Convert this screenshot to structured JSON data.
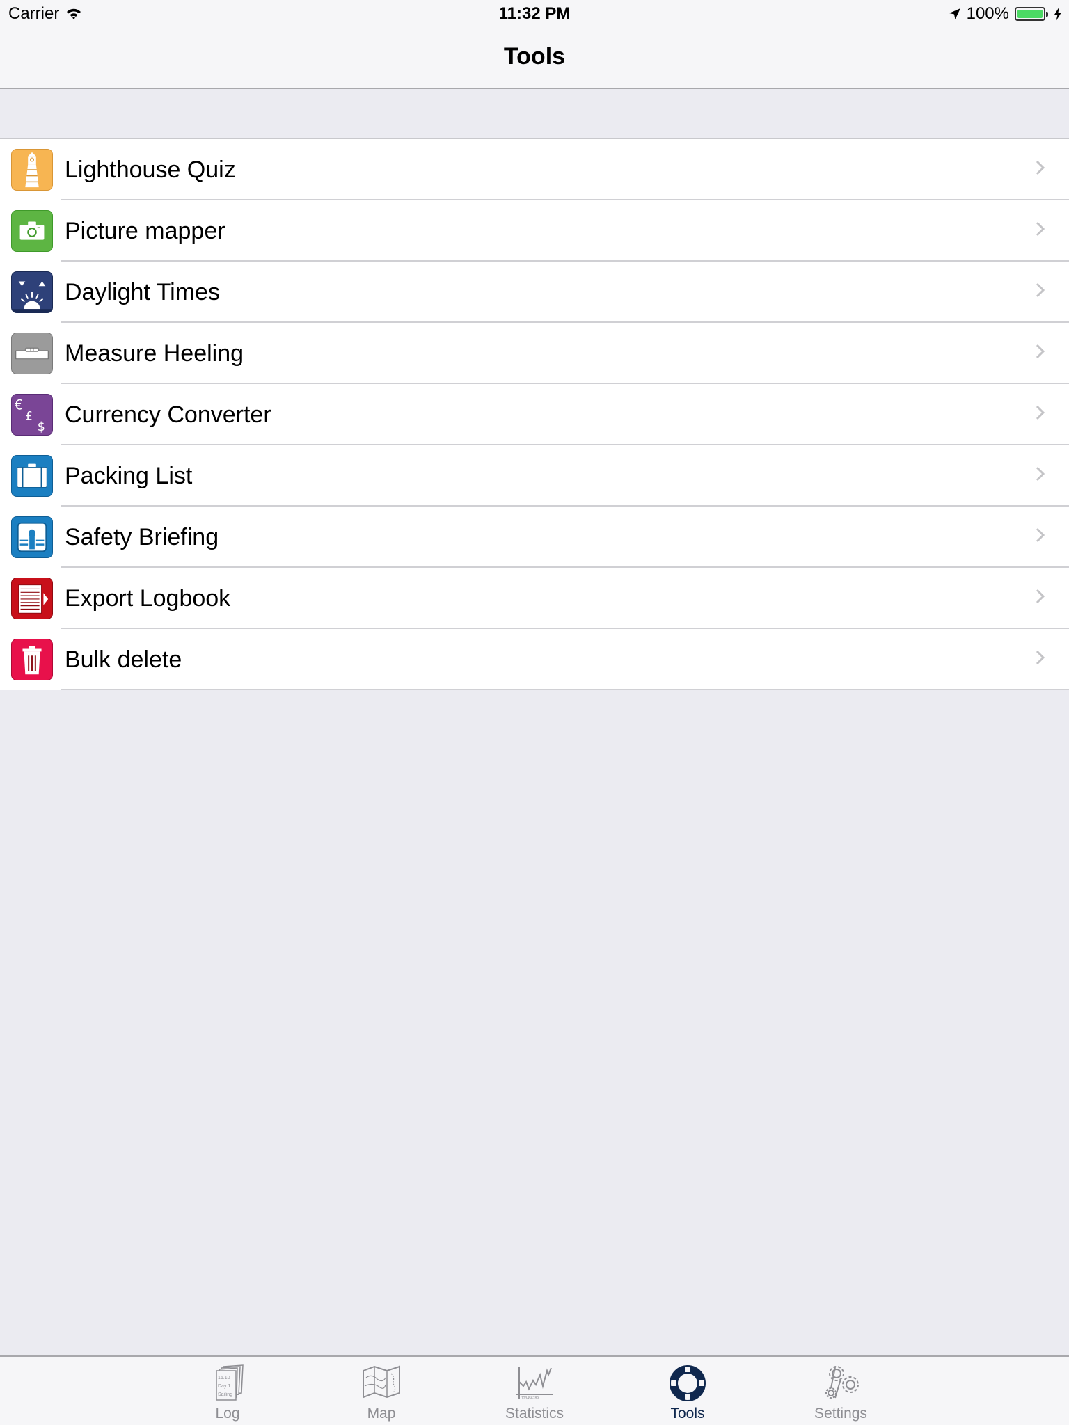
{
  "status_bar": {
    "carrier": "Carrier",
    "time": "11:32 PM",
    "battery_percent_text": "100%",
    "battery_level": 1.0,
    "icons": [
      "wifi-icon",
      "location-arrow-icon",
      "battery-icon",
      "charging-bolt-icon"
    ]
  },
  "nav_bar": {
    "title": "Tools"
  },
  "tools": {
    "items": [
      {
        "label": "Lighthouse Quiz",
        "icon": "lighthouse-icon",
        "color": "#f7b552"
      },
      {
        "label": "Picture mapper",
        "icon": "camera-icon",
        "color": "#5db543"
      },
      {
        "label": "Daylight Times",
        "icon": "sunrise-icon",
        "color": "#2e4179"
      },
      {
        "label": "Measure Heeling",
        "icon": "spirit-level-icon",
        "color": "#9b9b9b"
      },
      {
        "label": "Currency Converter",
        "icon": "currency-icon",
        "color": "#7a4596"
      },
      {
        "label": "Packing List",
        "icon": "suitcase-icon",
        "color": "#1b7fc1"
      },
      {
        "label": "Safety Briefing",
        "icon": "life-jacket-icon",
        "color": "#1b7fc1"
      },
      {
        "label": "Export Logbook",
        "icon": "export-document-icon",
        "color": "#c8101a"
      },
      {
        "label": "Bulk delete",
        "icon": "trash-icon",
        "color": "#e8114b"
      }
    ]
  },
  "tab_bar": {
    "active_color": "#10284e",
    "inactive_color": "#8e8e93",
    "tabs": [
      {
        "label": "Log",
        "icon": "logbook-icon",
        "active": false,
        "icon_text": [
          "16.10",
          "Day 1",
          "Sailing"
        ]
      },
      {
        "label": "Map",
        "icon": "map-icon",
        "active": false
      },
      {
        "label": "Statistics",
        "icon": "chart-icon",
        "active": false,
        "icon_text": [
          "123456789"
        ]
      },
      {
        "label": "Tools",
        "icon": "lifebuoy-icon",
        "active": true
      },
      {
        "label": "Settings",
        "icon": "gears-icon",
        "active": false
      }
    ]
  }
}
